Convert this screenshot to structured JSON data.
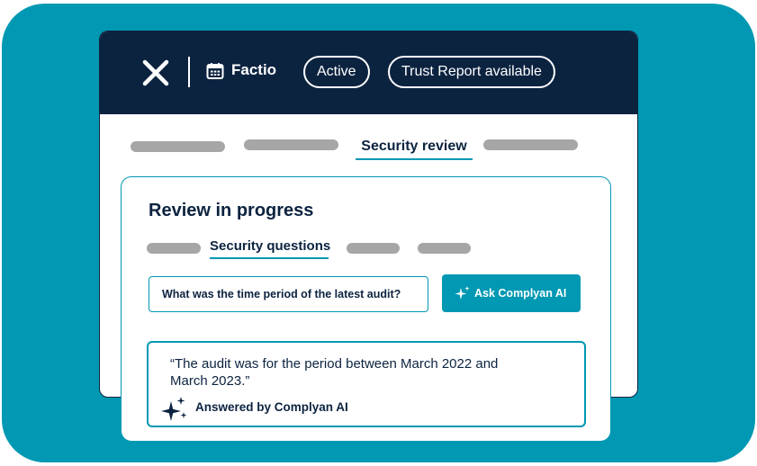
{
  "header": {
    "company": "Factio",
    "status_pill": "Active",
    "trust_pill": "Trust Report available"
  },
  "tabs": {
    "active_label": "Security review"
  },
  "card": {
    "title": "Review in progress",
    "active_subtab": "Security questions",
    "question": "What was the time period of the latest audit?",
    "ask_button": "Ask Complyan AI",
    "answer": "“The audit was for the period between March 2022 and March 2023.”",
    "answered_by": "Answered by Complyan AI"
  },
  "colors": {
    "teal": "#0098b3",
    "navy": "#0c2340",
    "placeholder_gray": "#a6a6a6"
  }
}
